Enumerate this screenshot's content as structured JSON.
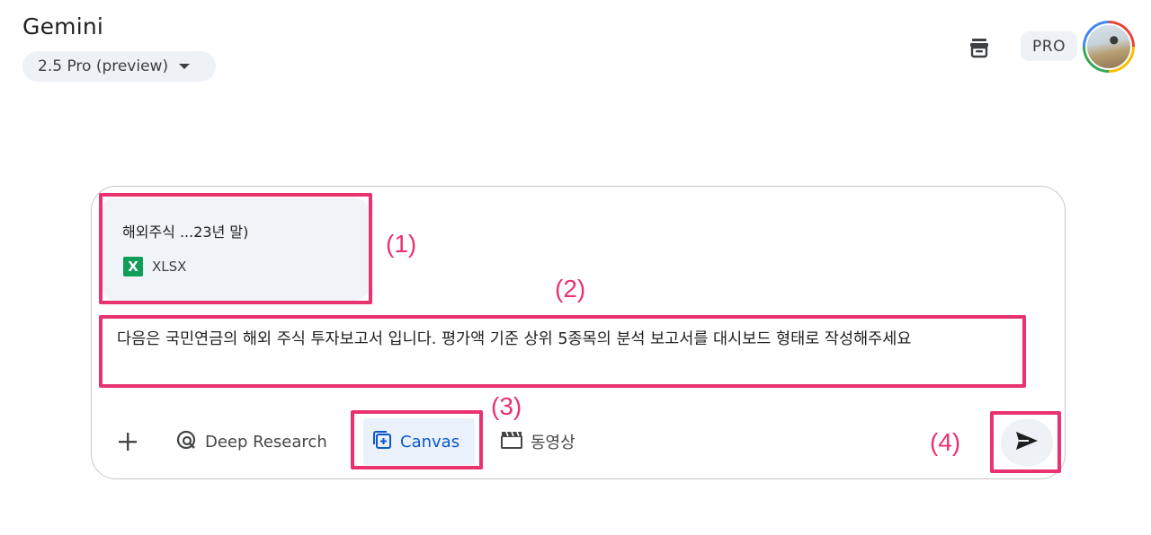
{
  "header": {
    "app_title": "Gemini",
    "model_label": "2.5 Pro (preview)",
    "pro_badge": "PRO",
    "icons": {
      "chat_history": "archive-box-icon",
      "avatar": "user-avatar"
    }
  },
  "attachment": {
    "file_name": "해외주식 ...23년 말)",
    "file_type_icon": "X",
    "file_type": "XLSX"
  },
  "prompt": {
    "text": "다음은 국민연금의 해외 주식 투자보고서 입니다. 평가액 기준 상위 5종목의 분석 보고서를 대시보드 형태로 작성해주세요"
  },
  "toolbar": {
    "add_icon": "plus-icon",
    "deep_research_label": "Deep Research",
    "canvas_label": "Canvas",
    "video_label": "동영상",
    "send_icon": "send-icon"
  },
  "annotations": {
    "label_1": "(1)",
    "label_2": "(2)",
    "label_3": "(3)",
    "label_4": "(4)"
  },
  "colors": {
    "annotation": "#e8336e",
    "canvas_accent": "#0b57d0",
    "xlsx_green": "#0f9d58"
  }
}
